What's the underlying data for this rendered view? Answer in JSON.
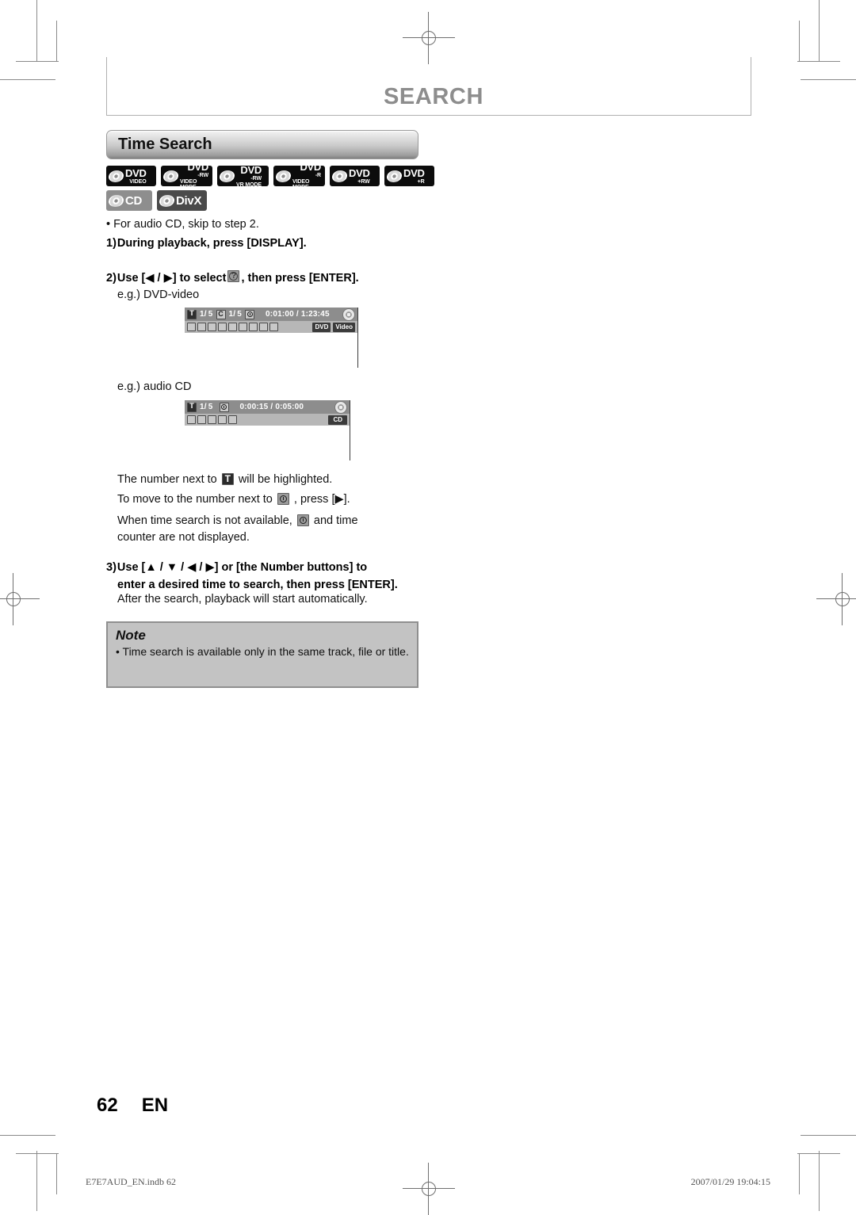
{
  "page_header": {
    "title": "SEARCH"
  },
  "section": {
    "title": "Time Search"
  },
  "disc_badges": [
    {
      "name": "DVD VIDEO",
      "line1": "DVD",
      "line2": "VIDEO",
      "style": "blk"
    },
    {
      "name": "DVD-RW Video Mode",
      "line1": "DVD",
      "line2": "-RW",
      "line3": "VIDEO MODE",
      "style": "blk"
    },
    {
      "name": "DVD-RW VR Mode",
      "line1": "DVD",
      "line2": "-RW",
      "line3": "VR MODE",
      "style": "blk"
    },
    {
      "name": "DVD-R Video Mode",
      "line1": "DVD",
      "line2": "-R",
      "line3": "VIDEO MODE",
      "style": "blk"
    },
    {
      "name": "DVD+RW",
      "line1": "DVD",
      "line2": "+RW",
      "style": "blk"
    },
    {
      "name": "DVD+R",
      "line1": "DVD",
      "line2": "+R",
      "style": "blk"
    },
    {
      "name": "CD",
      "line1": "CD",
      "line2": "",
      "style": "gry"
    },
    {
      "name": "DivX",
      "line1": "DivX",
      "line2": "",
      "style": "dgy"
    }
  ],
  "bullet_pre": "• For audio CD, skip to step 2.",
  "steps": [
    {
      "num": "1)",
      "bold_a": "During playback, press [DISPLAY]."
    },
    {
      "num": "2)",
      "bold_a": "Use [◀ / ▶] to select",
      "bold_b": ", then press [ENTER].",
      "icon": "question-icon"
    },
    {
      "num": "3)",
      "bold_a": "Use [▲ / ▼ / ◀ / ▶] or [the Number buttons] to",
      "bold_b": "enter a desired time to search, then press [ENTER].",
      "sub": "After the search, playback will start automatically."
    }
  ],
  "examples": {
    "dvd_label": "e.g.) DVD-video",
    "cd_label": "e.g.) audio CD"
  },
  "osd_dvd": {
    "title_icon": "title-icon",
    "title_value": "1/",
    "title_total": "5",
    "chapter_icon": "chapter-icon",
    "chapter_value": "1/",
    "chapter_total": "5",
    "clock_icon": "clock-icon",
    "time": "0:01:00 / 1:23:45",
    "disc_icon": "disc-icon",
    "row2_icons": [
      "search-icon",
      "audio-icon",
      "subtitle-icon",
      "angle-icon",
      "repeat-icon",
      "bitrate-icon",
      "noise-reduction-icon",
      "zoom-icon",
      "picture-icon"
    ],
    "tags": [
      "DVD",
      "Video"
    ]
  },
  "osd_cd": {
    "title_icon": "title-icon",
    "title_value": "1/",
    "title_total": "5",
    "clock_icon": "clock-icon",
    "time": "0:00:15 / 0:05:00",
    "disc_icon": "disc-icon",
    "row2_icons": [
      "search-icon",
      "audio-icon",
      "repeat-icon",
      "bitrate-icon",
      "picture-icon"
    ],
    "tags": [
      "CD"
    ]
  },
  "paragraphs": {
    "p1_a": "The number next to",
    "p1_b": "will be highlighted.",
    "p2_a": "To move to the number next to",
    "p2_b": ", press [▶].",
    "p3_a": "When time search is not available,",
    "p3_b": "and time",
    "p3_c": "counter are not displayed."
  },
  "note": {
    "heading": "Note",
    "body": "• Time search is available only in the same track, file or title."
  },
  "folio": {
    "page": "62",
    "lang": "EN"
  },
  "footer": {
    "left": "E7E7AUD_EN.indb   62",
    "right": "2007/01/29   19:04:15"
  }
}
